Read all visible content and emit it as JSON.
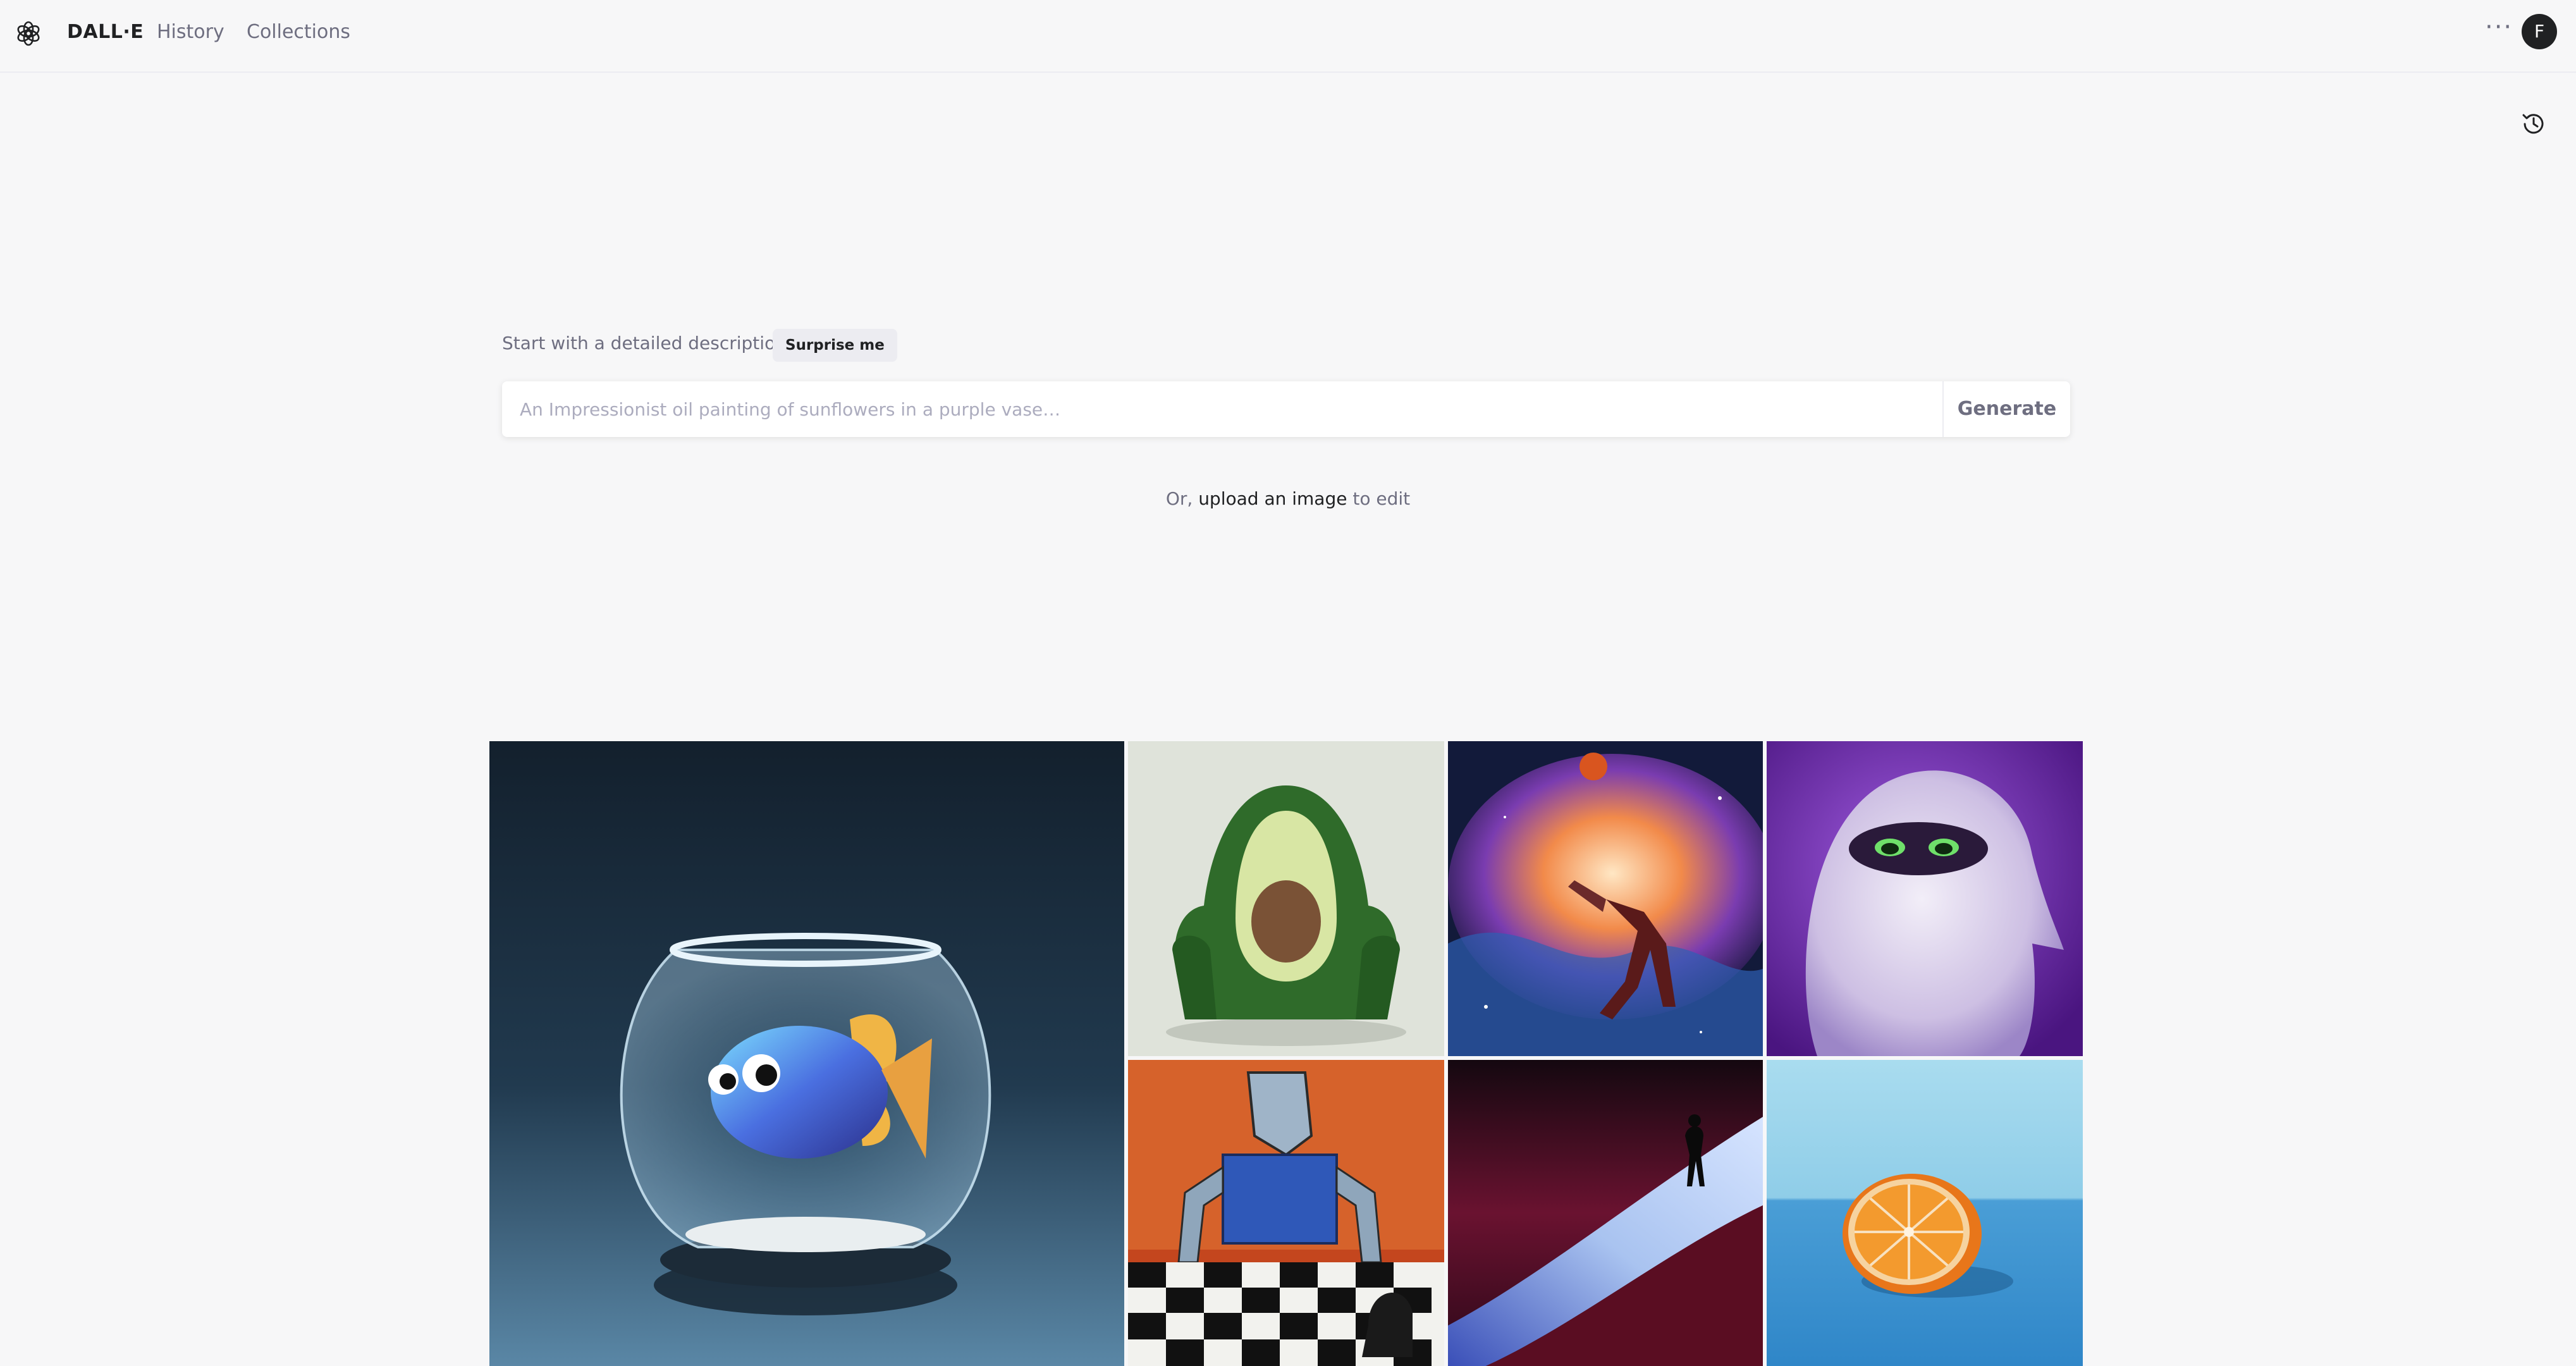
{
  "header": {
    "brand": "DALL·E",
    "nav": [
      "History",
      "Collections"
    ],
    "avatar_initial": "F",
    "more_label": "···"
  },
  "prompt": {
    "label": "Start with a detailed description",
    "surprise_button": "Surprise me",
    "placeholder": "An Impressionist oil painting of sunflowers in a purple vase…",
    "value": "",
    "generate_button": "Generate"
  },
  "upload": {
    "prefix": "Or,",
    "link": "upload an image",
    "suffix": "to edit"
  },
  "icons": {
    "logo": "openai-logo-icon",
    "history": "history-clock-icon",
    "more": "more-dots-icon"
  },
  "gallery": [
    {
      "name": "fish-bowl-image"
    },
    {
      "name": "avocado-chair-image"
    },
    {
      "name": "space-dunk-painting-image"
    },
    {
      "name": "purple-monster-image"
    },
    {
      "name": "robot-chess-painting-image"
    },
    {
      "name": "desert-dunes-image"
    },
    {
      "name": "orange-half-image"
    }
  ],
  "colors": {
    "background": "#f7f7f8",
    "text_primary": "#202123",
    "text_secondary": "#6e6e80",
    "border": "#ececf1"
  }
}
